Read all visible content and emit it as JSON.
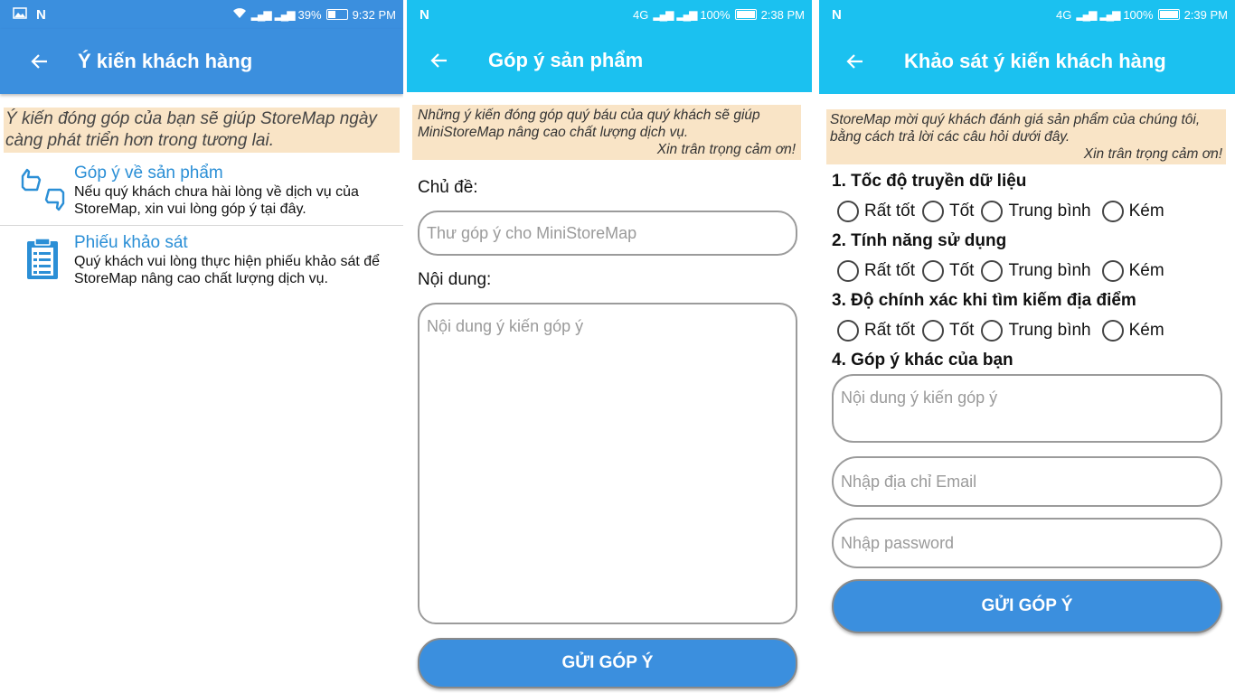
{
  "screen1": {
    "status": {
      "left_icons": [
        "image-icon",
        "n-icon"
      ],
      "battery": "39%",
      "time": "9:32 PM",
      "left_text": "N"
    },
    "title": "Ý kiến khách hàng",
    "notice": "Ý kiến đóng góp của bạn sẽ giúp StoreMap ngày càng phát triển hơn trong tương lai.",
    "items": [
      {
        "icon": "thumbs-up-down-icon",
        "title": "Góp ý về sản phẩm",
        "desc": "Nếu quý khách chưa hài lòng về dịch vụ của StoreMap, xin vui lòng góp ý tại đây."
      },
      {
        "icon": "clipboard-icon",
        "title": "Phiếu khảo sát",
        "desc": "Quý khách vui lòng thực hiện phiếu khảo sát để StoreMap nâng cao chất lượng dịch vụ."
      }
    ]
  },
  "screen2": {
    "status": {
      "left_text": "N",
      "network": "4G",
      "battery": "100%",
      "time": "2:38 PM"
    },
    "title": "Góp ý sản phẩm",
    "notice": "Những ý kiến đóng góp quý báu của quý khách sẽ giúp MiniStoreMap nâng cao chất lượng dịch vụ.",
    "notice_thanks": "Xin trân trọng cảm ơn!",
    "subject_label": "Chủ đề:",
    "subject_placeholder": "Thư góp ý cho MiniStoreMap",
    "content_label": "Nội dung:",
    "content_placeholder": "Nội dung ý kiến góp ý",
    "submit": "GỬI GÓP Ý"
  },
  "screen3": {
    "status": {
      "left_text": "N",
      "network": "4G",
      "battery": "100%",
      "time": "2:39 PM"
    },
    "title": "Khảo sát ý kiến khách hàng",
    "notice": "StoreMap mời quý khách đánh giá sản phẩm của chúng tôi, bằng cách trả lời các câu hỏi dưới đây.",
    "notice_thanks": "Xin trân trọng cảm ơn!",
    "questions": [
      {
        "label": "1. Tốc độ truyền dữ liệu",
        "options": [
          "Rất tốt",
          "Tốt",
          "Trung bình",
          "Kém"
        ]
      },
      {
        "label": "2. Tính năng sử dụng",
        "options": [
          "Rất tốt",
          "Tốt",
          "Trung bình",
          "Kém"
        ]
      },
      {
        "label": "3. Độ chính xác khi tìm kiếm địa điểm",
        "options": [
          "Rất tốt",
          "Tốt",
          "Trung bình",
          "Kém"
        ]
      }
    ],
    "q4_label": "4. Góp ý khác của bạn",
    "feedback_placeholder": "Nội dung ý kiến góp ý",
    "email_placeholder": "Nhập địa chỉ Email",
    "password_placeholder": "Nhập password",
    "submit": "GỬI GÓP Ý"
  }
}
